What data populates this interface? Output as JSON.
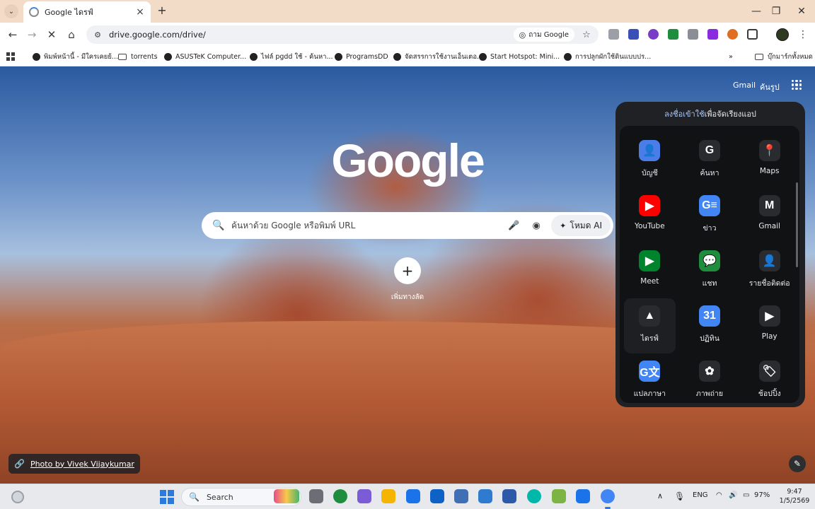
{
  "browser": {
    "tab_title": "Google ไดรฟ์",
    "url": "drive.google.com/drive/",
    "lens_chip": "ถาม Google",
    "window_controls": [
      "—",
      "❐",
      "✕"
    ]
  },
  "bookmarks": [
    {
      "label": "พิมพ์หน้านี้ - มีใครเคยย้...",
      "type": "site"
    },
    {
      "label": "torrents",
      "type": "folder"
    },
    {
      "label": "ASUSTeK Computer...",
      "type": "site"
    },
    {
      "label": "ไฟล์ pgdd ใช้ - ค้นหา...",
      "type": "site"
    },
    {
      "label": "ProgramsDD",
      "type": "site"
    },
    {
      "label": "จัดสรรการใช้งานเอ็นเตอ...",
      "type": "site"
    },
    {
      "label": "Start Hotspot: Mini...",
      "type": "site"
    },
    {
      "label": "การปลูกผักใช้ดินแบบปร...",
      "type": "site"
    }
  ],
  "bookmarks_all": "บุ๊กมาร์กทั้งหมด",
  "newtab": {
    "gmail_link": "Gmail",
    "images_link": "ค้นรูป",
    "logo": "Google",
    "search_placeholder": "ค้นหาด้วย Google หรือพิมพ์ URL",
    "ai_mode": "โหมด AI",
    "add_shortcut": "เพิ่มทางลัด",
    "photo_credit": "Photo by Vivek Vijaykumar"
  },
  "apps_panel": {
    "signin_link": "ลงชื่อเข้าใช้",
    "signin_rest": "เพื่อจัดเรียงแอป",
    "apps": [
      {
        "label": "บัญชี",
        "icon": "account-icon",
        "color": "#4a7de8",
        "glyph": "👤"
      },
      {
        "label": "ค้นหา",
        "icon": "google-search-icon",
        "color": "#2a2b2e",
        "glyph": "G"
      },
      {
        "label": "Maps",
        "icon": "maps-icon",
        "color": "#2a2b2e",
        "glyph": "📍"
      },
      {
        "label": "YouTube",
        "icon": "youtube-icon",
        "color": "#ff0000",
        "glyph": "▶"
      },
      {
        "label": "ข่าว",
        "icon": "news-icon",
        "color": "#4285f4",
        "glyph": "G≡"
      },
      {
        "label": "Gmail",
        "icon": "gmail-icon",
        "color": "#2a2b2e",
        "glyph": "M"
      },
      {
        "label": "Meet",
        "icon": "meet-icon",
        "color": "#00832d",
        "glyph": "▶"
      },
      {
        "label": "แชท",
        "icon": "chat-icon",
        "color": "#1e8e3e",
        "glyph": "💬"
      },
      {
        "label": "รายชื่อติดต่อ",
        "icon": "contacts-icon",
        "color": "#2a2b2e",
        "glyph": "👤"
      },
      {
        "label": "ไดรฟ์",
        "icon": "drive-icon",
        "color": "#2a2b2e",
        "glyph": "▲"
      },
      {
        "label": "ปฏิทิน",
        "icon": "calendar-icon",
        "color": "#4285f4",
        "glyph": "31"
      },
      {
        "label": "Play",
        "icon": "play-icon",
        "color": "#2a2b2e",
        "glyph": "▶"
      },
      {
        "label": "แปลภาษา",
        "icon": "translate-icon",
        "color": "#4285f4",
        "glyph": "G文"
      },
      {
        "label": "ภาพถ่าย",
        "icon": "photos-icon",
        "color": "#2a2b2e",
        "glyph": "✿"
      },
      {
        "label": "ช้อปปิ้ง",
        "icon": "shopping-icon",
        "color": "#2a2b2e",
        "glyph": "🏷"
      }
    ]
  },
  "taskbar": {
    "search": "Search",
    "lang": "ENG",
    "battery": "97%",
    "time": "9:47",
    "date": "1/5/2569"
  }
}
